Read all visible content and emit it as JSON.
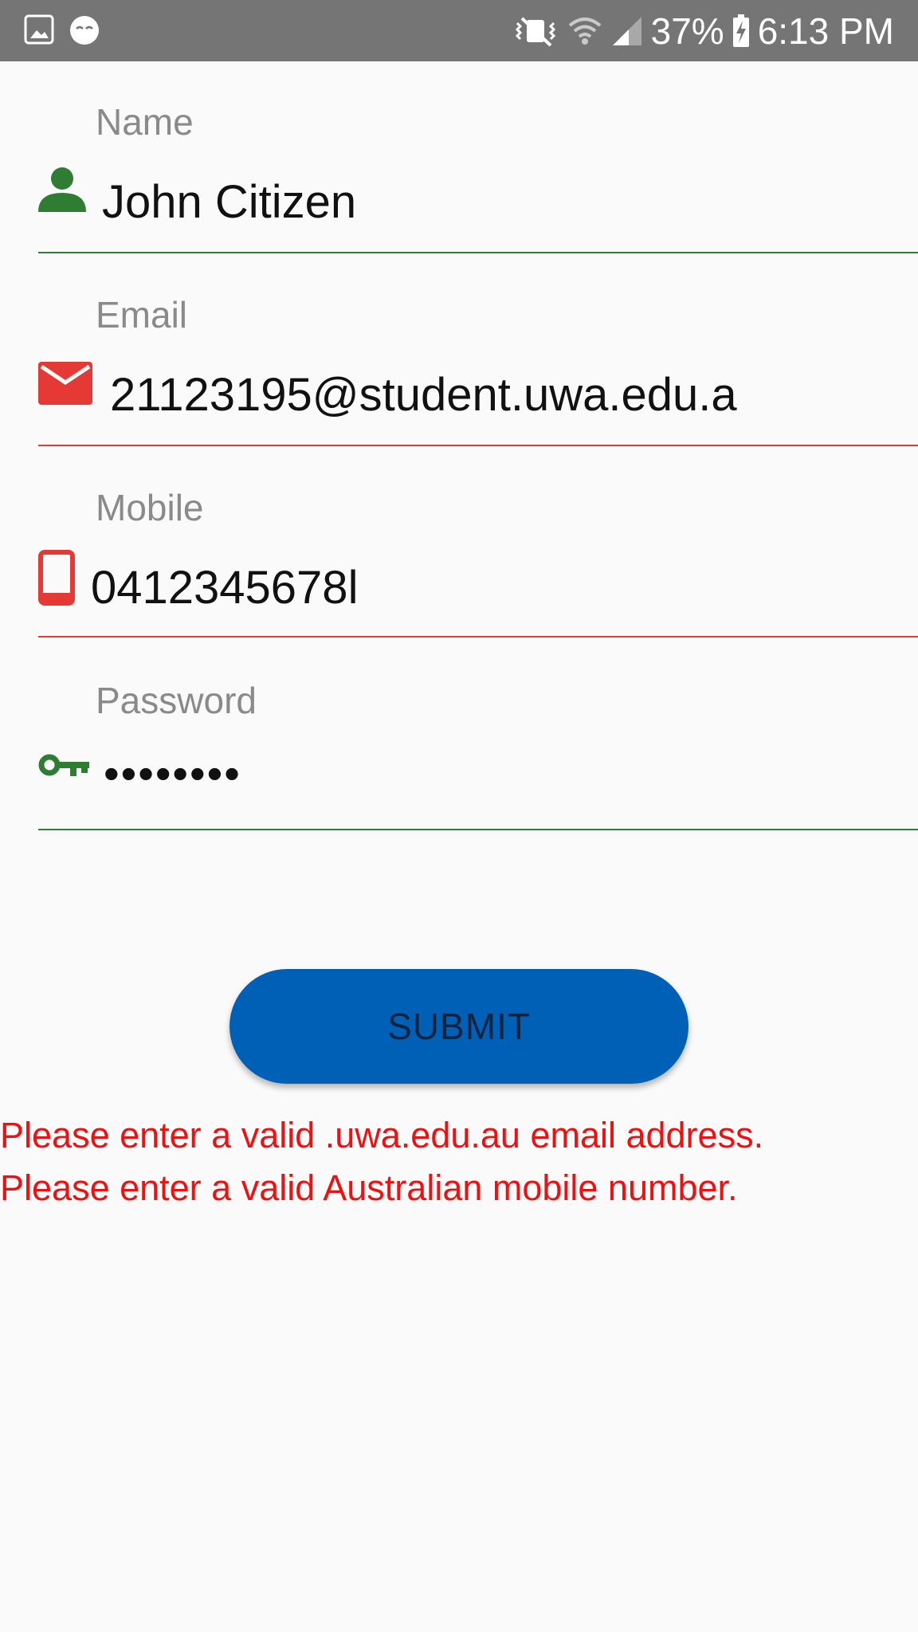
{
  "status_bar": {
    "battery": "37%",
    "time": "6:13 PM",
    "icons": [
      "gallery-icon",
      "emoji-icon",
      "mute-vibrate-icon",
      "wifi-icon",
      "signal-icon",
      "battery-charging-icon"
    ]
  },
  "form": {
    "name": {
      "label": "Name",
      "value": "John Citizen",
      "icon": "person-icon",
      "color": "#2e7d32"
    },
    "email": {
      "label": "Email",
      "value": "21123195@student.uwa.edu.a",
      "icon": "email-icon",
      "color": "#e53935"
    },
    "mobile": {
      "label": "Mobile",
      "value": "0412345678l",
      "icon": "phone-icon",
      "color": "#e53935"
    },
    "password": {
      "label": "Password",
      "value": "••••••••",
      "icon": "key-icon",
      "color": "#2e7d32"
    }
  },
  "submit": {
    "label": "SUBMIT",
    "color": "#0060b6"
  },
  "errors": {
    "email": "Please enter a valid .uwa.edu.au email address.",
    "mobile": "Please enter a valid Australian mobile number."
  }
}
